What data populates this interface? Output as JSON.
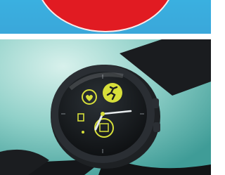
{
  "banner": {
    "colors": {
      "background": "#3aa7da",
      "badge": "#e11b22"
    }
  },
  "photo": {
    "subject": "smartwatch",
    "colors": {
      "background": "#8fd0c8",
      "case": "#1d1f22",
      "accent": "#d7df3a"
    },
    "icons": [
      "heart-icon",
      "running-icon",
      "steps-icon",
      "calendar-icon"
    ]
  }
}
